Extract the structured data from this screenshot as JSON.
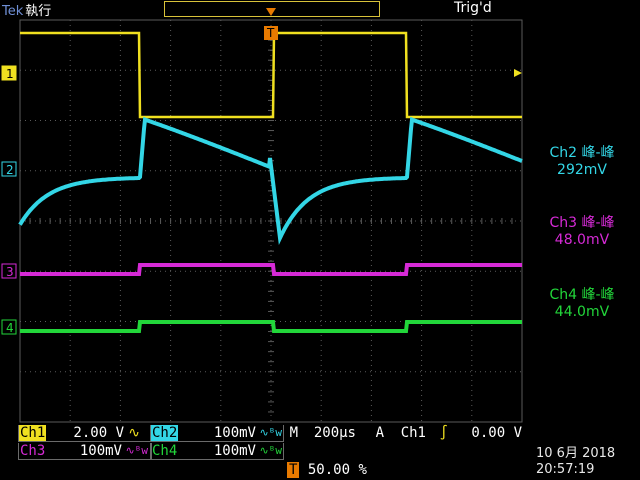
{
  "brand": "Tek",
  "run_state": "執行",
  "trigger_state": "Trig'd",
  "ground_markers": [
    "1",
    "2",
    "3",
    "4"
  ],
  "trigger_marker": "T",
  "readouts": [
    {
      "label": "Ch2 峰-峰",
      "value": "292mV",
      "color": "#33d6e6"
    },
    {
      "label": "Ch3 峰-峰",
      "value": "48.0mV",
      "color": "#d62ad6"
    },
    {
      "label": "Ch4 峰-峰",
      "value": "44.0mV",
      "color": "#22d63a"
    }
  ],
  "channels": {
    "ch1": {
      "name": "Ch1",
      "scale": "2.00 V",
      "coupling": "∿",
      "color": "#f0e020"
    },
    "ch2": {
      "name": "Ch2",
      "scale": "100mV",
      "coupling": "∿ᴮw",
      "color": "#33d6e6"
    },
    "ch3": {
      "name": "Ch3",
      "scale": "100mV",
      "coupling": "∿ᴮw",
      "color": "#d62ad6"
    },
    "ch4": {
      "name": "Ch4",
      "scale": "100mV",
      "coupling": "∿ᴮw",
      "color": "#22d63a"
    }
  },
  "timebase": {
    "label": "M",
    "value": "200µs"
  },
  "trigger": {
    "mode": "A",
    "source": "Ch1",
    "slope": "∫",
    "level": "0.00 V"
  },
  "trigger_position": {
    "icon": "T",
    "value": "50.00 %"
  },
  "date": "10 6月  2018",
  "time": "20:57:19",
  "colors": {
    "grid": "#5a5a5a",
    "accent_trigger": "#e87a00"
  }
}
